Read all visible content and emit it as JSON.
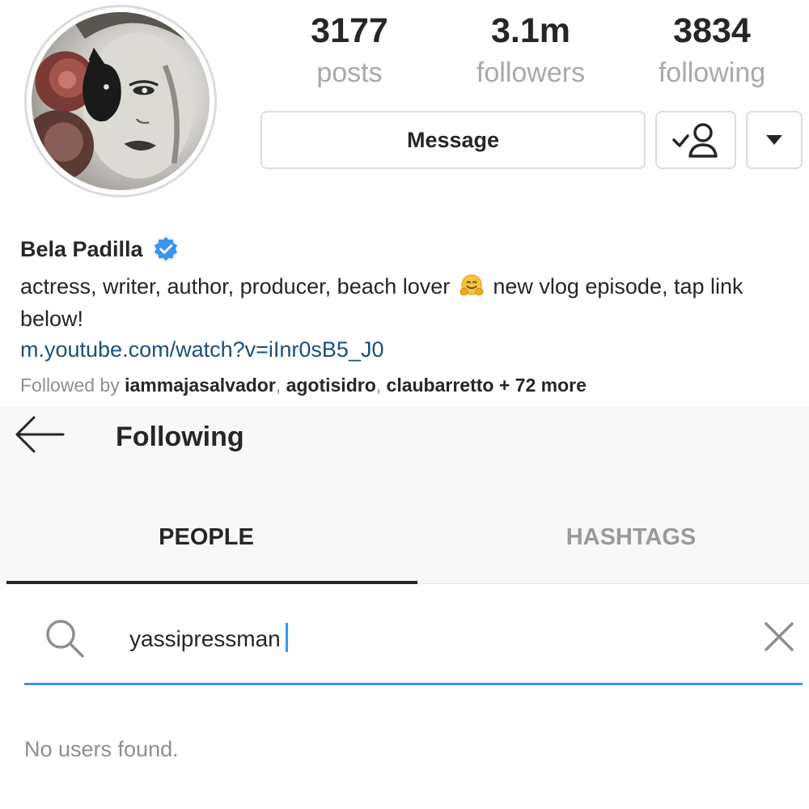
{
  "profile": {
    "name": "Bela Padilla",
    "verified": true,
    "bio_text": "actress, writer, author, producer, beach lover",
    "bio_emoji": "hugging-face-emoji",
    "bio_text_after": "new vlog episode, tap link below!",
    "link": "m.youtube.com/watch?v=iInr0sB5_J0",
    "followed_by": {
      "prefix": "Followed by",
      "accounts": [
        "iammajasalvador",
        "agotisidro",
        "claubarretto"
      ],
      "more": "+ 72 more"
    }
  },
  "stats": [
    {
      "value": "3177",
      "label": "posts"
    },
    {
      "value": "3.1m",
      "label": "followers"
    },
    {
      "value": "3834",
      "label": "following"
    }
  ],
  "actions": {
    "message_label": "Message",
    "following_icon": "user-check-icon",
    "more_icon": "caret-down-icon"
  },
  "following_panel": {
    "title": "Following",
    "tabs": [
      {
        "label": "PEOPLE",
        "active": true
      },
      {
        "label": "HASHTAGS",
        "active": false
      }
    ],
    "search": {
      "value": "yassipressman"
    },
    "empty_message": "No users found."
  },
  "colors": {
    "verified_blue": "#3897f0",
    "link_blue": "#1c4f7c",
    "search_underline": "#4a90d9",
    "muted_text": "#8e8e8e"
  }
}
